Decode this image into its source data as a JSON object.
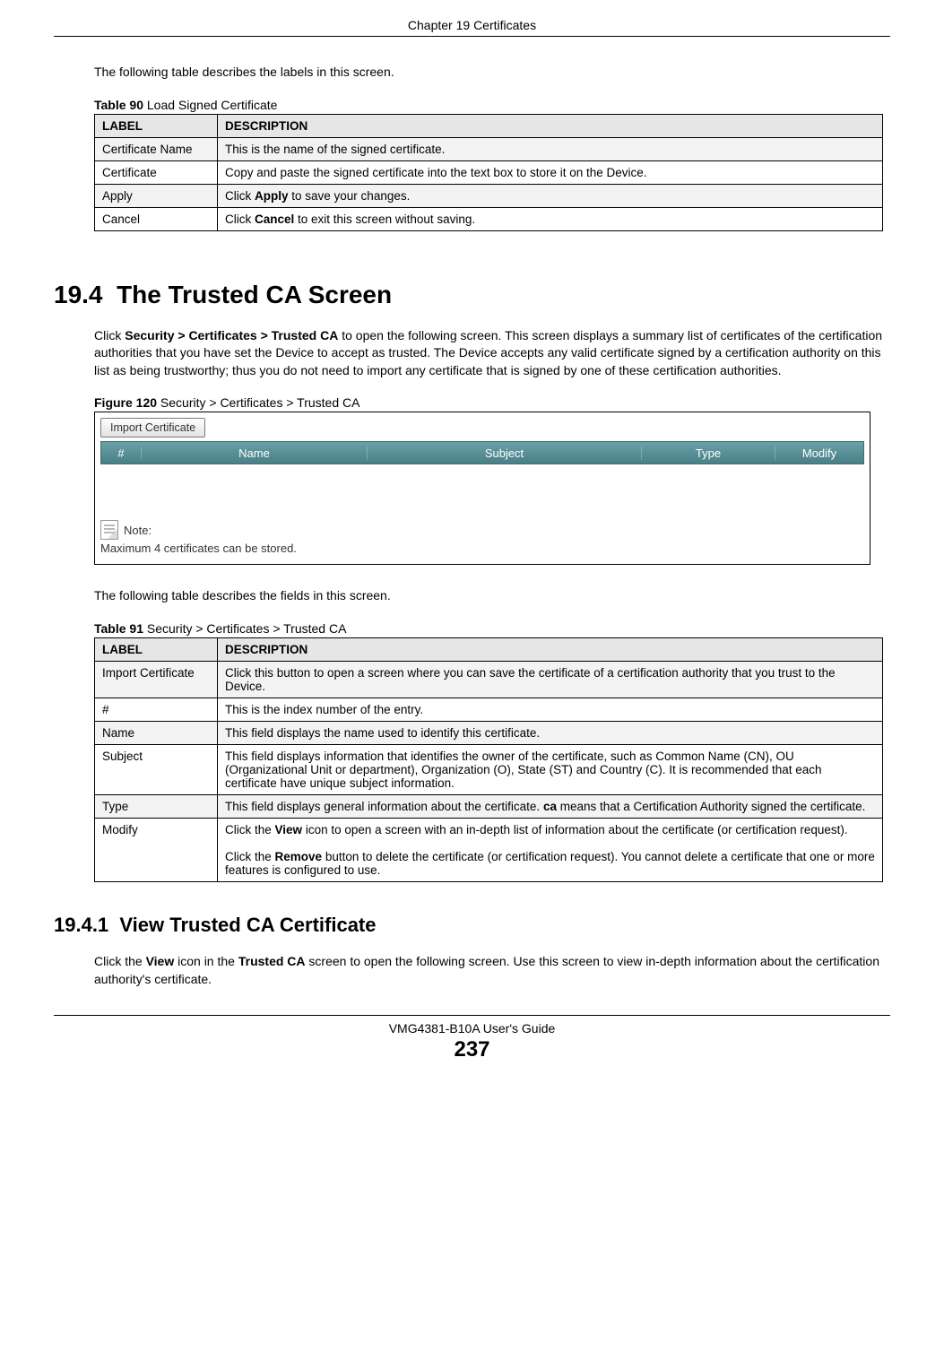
{
  "header": {
    "chapter": "Chapter 19 Certificates"
  },
  "intro1": "The following table describes the labels in this screen.",
  "table90": {
    "caption_bold": "Table 90",
    "caption_rest": "   Load Signed Certificate",
    "head_label": "LABEL",
    "head_desc": "DESCRIPTION",
    "rows": [
      {
        "label": "Certificate Name",
        "desc": "This is the name of the signed certificate."
      },
      {
        "label": "Certificate",
        "desc": "Copy and paste the signed certificate into the text box to store it on the Device."
      },
      {
        "label": "Apply",
        "desc_pre": "Click ",
        "desc_b": "Apply",
        "desc_post": " to save your changes."
      },
      {
        "label": "Cancel",
        "desc_pre": "Click ",
        "desc_b": "Cancel",
        "desc_post": " to exit this screen without saving."
      }
    ]
  },
  "section194": {
    "num": "19.4",
    "title": "The Trusted CA Screen",
    "para_pre": "Click ",
    "para_b": "Security > Certificates > Trusted CA",
    "para_post": " to open the following screen. This screen displays a summary list of certificates of the certification authorities that you have set the Device to accept as trusted. The Device accepts any valid certificate signed by a certification authority on this list as being trustworthy; thus you do not need to import any certificate that is signed by one of these certification authorities."
  },
  "figure120": {
    "caption_bold": "Figure 120",
    "caption_rest": "   Security > Certificates > Trusted CA",
    "import_btn": "Import Certificate",
    "cols": {
      "num": "#",
      "name": "Name",
      "subject": "Subject",
      "type": "Type",
      "modify": "Modify"
    },
    "note_label": "Note:",
    "max_text": "Maximum 4 certificates can be stored."
  },
  "intro2": "The following table describes the fields in this screen.",
  "table91": {
    "caption_bold": "Table 91",
    "caption_rest": "   Security > Certificates > Trusted CA",
    "head_label": "LABEL",
    "head_desc": "DESCRIPTION",
    "rows": {
      "r0": {
        "label": "Import Certificate",
        "desc": "Click this button to open a screen where you can save the certificate of a certification authority that you trust to the Device."
      },
      "r1": {
        "label": "#",
        "desc": "This is the index number of the entry."
      },
      "r2": {
        "label": "Name",
        "desc": "This field displays the name used to identify this certificate."
      },
      "r3": {
        "label": "Subject",
        "desc": "This field displays information that identifies the owner of the certificate, such as Common Name (CN), OU (Organizational Unit or department), Organization (O), State (ST) and Country (C). It is recommended that each certificate have unique subject information."
      },
      "r4": {
        "label": "Type",
        "desc_pre": "This field displays general information about the certificate. ",
        "desc_b": "ca",
        "desc_post": " means that a Certification Authority signed the certificate."
      },
      "r5": {
        "label": "Modify",
        "p1_pre": "Click the ",
        "p1_b": "View",
        "p1_post": " icon to open a screen with an in-depth list of information about the certificate (or certification request).",
        "p2_pre": "Click the ",
        "p2_b": "Remove",
        "p2_post": " button to delete the certificate (or certification request). You cannot delete a certificate that one or more features is configured to use."
      }
    }
  },
  "section1941": {
    "num": "19.4.1",
    "title": "View Trusted CA Certificate",
    "para_pre": "Click the ",
    "para_b1": "View",
    "para_mid": " icon in the ",
    "para_b2": "Trusted CA",
    "para_post": " screen to open the following screen. Use this screen to view in-depth information about the certification authority's certificate."
  },
  "footer": {
    "guide": "VMG4381-B10A User's Guide",
    "page": "237"
  }
}
